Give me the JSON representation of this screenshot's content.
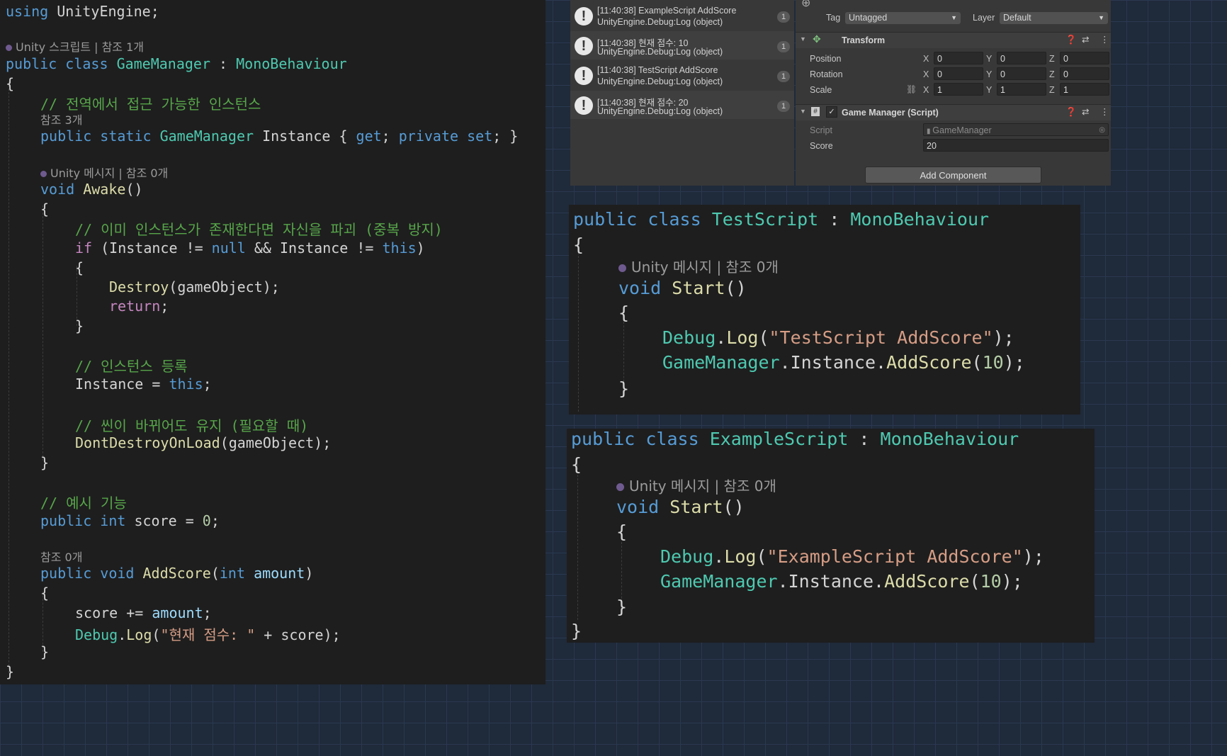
{
  "left_editor": {
    "lines": {
      "using": [
        "using",
        " UnityEngine;"
      ],
      "lens_script": "Unity 스크립트 | 참조 1개",
      "class_decl": [
        "public",
        " ",
        "class",
        " ",
        "GameManager",
        " : ",
        "MonoBehaviour"
      ],
      "open1": "{",
      "comment_instance": "// 전역에서 접근 가능한 인스턴스",
      "ref3": "참조 3개",
      "instance_decl": [
        "public",
        " ",
        "static",
        " ",
        "GameManager",
        " Instance { ",
        "get",
        "; ",
        "private",
        " ",
        "set",
        "; }"
      ],
      "lens_awake": "Unity 메시지 | 참조 0개",
      "awake_decl": [
        "void",
        " ",
        "Awake",
        "()"
      ],
      "open2": "{",
      "comment_destroy": "// 이미 인스턴스가 존재한다면 자신을 파괴 (중복 방지)",
      "if_line": [
        "if",
        " (Instance != ",
        "null",
        " && Instance != ",
        "this",
        ")"
      ],
      "open3": "{",
      "destroy_line": [
        "Destroy",
        "(gameObject);"
      ],
      "return_line": [
        "return",
        ";"
      ],
      "close3": "}",
      "comment_register": "// 인스턴스 등록",
      "assign_line": [
        "Instance = ",
        "this",
        ";"
      ],
      "comment_keep": "// 씬이 바뀌어도 유지 (필요할 때)",
      "dontdestroy_line": [
        "DontDestroyOnLoad",
        "(gameObject);"
      ],
      "close2": "}",
      "comment_example": "// 예시 기능",
      "score_decl": [
        "public",
        " ",
        "int",
        " score = ",
        "0",
        ";"
      ],
      "ref0": "참조 0개",
      "addscore_decl": [
        "public",
        " ",
        "void",
        " ",
        "AddScore",
        "(",
        "int",
        " ",
        "amount",
        ")"
      ],
      "open4": "{",
      "score_add": [
        "score += ",
        "amount",
        ";"
      ],
      "debug_line": [
        "Debug",
        ".",
        "Log",
        "(",
        "\"현재 점수: \"",
        " + score);"
      ],
      "close4": "}",
      "close1": "}"
    }
  },
  "console": {
    "entries": [
      {
        "line1": "[11:40:38] ExampleScript AddScore",
        "line2": "UnityEngine.Debug:Log (object)",
        "count": "1"
      },
      {
        "line1": "[11:40:38] 현재 점수: 10",
        "line2": "UnityEngine.Debug:Log (object)",
        "count": "1"
      },
      {
        "line1": "[11:40:38] TestScript AddScore",
        "line2": "UnityEngine.Debug:Log (object)",
        "count": "1"
      },
      {
        "line1": "[11:40:38] 현재 점수: 20",
        "line2": "UnityEngine.Debug:Log (object)",
        "count": "1"
      }
    ]
  },
  "inspector": {
    "tag_label": "Tag",
    "tag_value": "Untagged",
    "layer_label": "Layer",
    "layer_value": "Default",
    "transform_title": "Transform",
    "position_label": "Position",
    "rotation_label": "Rotation",
    "scale_label": "Scale",
    "axis_x": "X",
    "axis_y": "Y",
    "axis_z": "Z",
    "position": [
      "0",
      "0",
      "0"
    ],
    "rotation": [
      "0",
      "0",
      "0"
    ],
    "scale": [
      "1",
      "1",
      "1"
    ],
    "script_component_title": "Game Manager (Script)",
    "script_label": "Script",
    "script_value": "GameManager",
    "score_label": "Score",
    "score_value": "20",
    "add_component": "Add Component"
  },
  "test_script": {
    "class_decl": [
      "public",
      " ",
      "class",
      " ",
      "TestScript",
      " : ",
      "MonoBehaviour"
    ],
    "open1": "{",
    "lens": "Unity 메시지 | 참조 0개",
    "start_decl": [
      "void",
      " ",
      "Start",
      "()"
    ],
    "open2": "{",
    "debug_line": [
      "Debug",
      ".",
      "Log",
      "(",
      "\"TestScript AddScore\"",
      ");"
    ],
    "gm_line": [
      "GameManager",
      ".Instance.",
      "AddScore",
      "(",
      "10",
      ");"
    ],
    "close2": "}"
  },
  "example_script": {
    "class_decl": [
      "public",
      " ",
      "class",
      " ",
      "ExampleScript",
      " : ",
      "MonoBehaviour"
    ],
    "open1": "{",
    "lens": "Unity 메시지 | 참조 0개",
    "start_decl": [
      "void",
      " ",
      "Start",
      "()"
    ],
    "open2": "{",
    "debug_line": [
      "Debug",
      ".",
      "Log",
      "(",
      "\"ExampleScript AddScore\"",
      ");"
    ],
    "gm_line": [
      "GameManager",
      ".Instance.",
      "AddScore",
      "(",
      "10",
      ");"
    ],
    "close2": "}",
    "close1": "}"
  },
  "colors": {
    "keyword": "#569cd6",
    "control_keyword": "#c586c0",
    "type": "#4ec9b0",
    "method": "#dcdcaa",
    "comment": "#57a64a",
    "string": "#d69d85",
    "number": "#b5cea8",
    "parameter": "#9cdcfe",
    "editor_bg": "#1e1e1e",
    "unity_panel_bg": "#383838"
  }
}
